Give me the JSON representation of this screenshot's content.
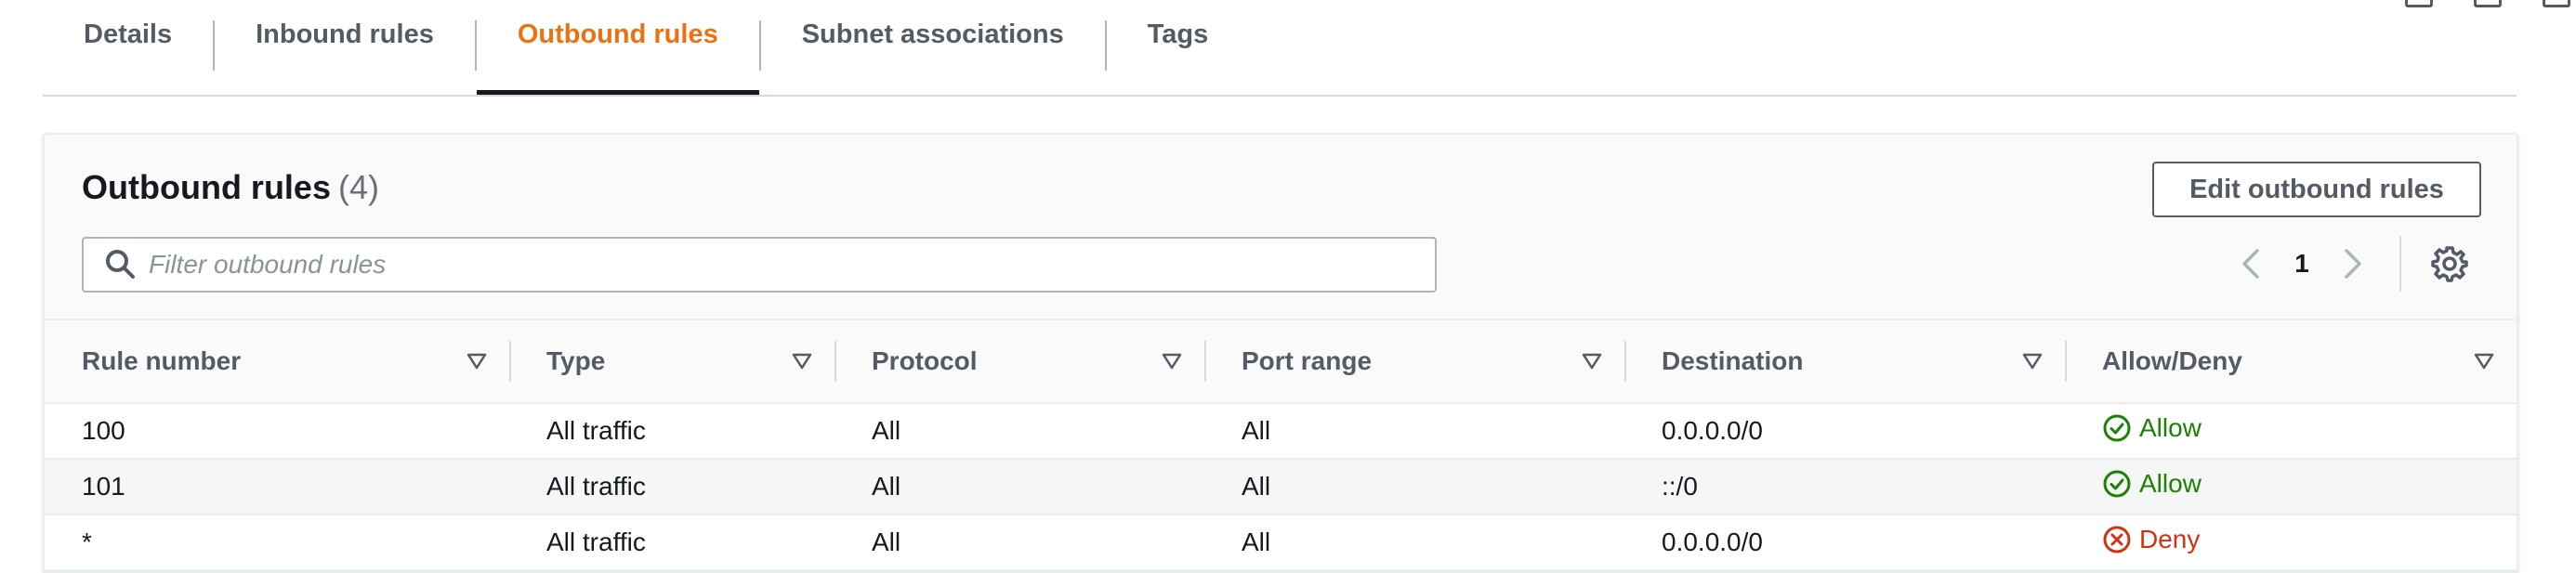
{
  "tabs": [
    {
      "label": "Details"
    },
    {
      "label": "Inbound rules"
    },
    {
      "label": "Outbound rules"
    },
    {
      "label": "Subnet associations"
    },
    {
      "label": "Tags"
    }
  ],
  "active_tab": "Outbound rules",
  "panel": {
    "title": "Outbound rules",
    "count": "(4)",
    "edit_button": "Edit outbound rules",
    "filter_placeholder": "Filter outbound rules",
    "page": "1"
  },
  "table": {
    "columns": [
      "Rule number",
      "Type",
      "Protocol",
      "Port range",
      "Destination",
      "Allow/Deny"
    ],
    "rows": [
      {
        "rule": "100",
        "type": "All traffic",
        "protocol": "All",
        "port": "All",
        "destination": "0.0.0.0/0",
        "action": "Allow"
      },
      {
        "rule": "101",
        "type": "All traffic",
        "protocol": "All",
        "port": "All",
        "destination": "::/0",
        "action": "Allow"
      },
      {
        "rule": "*",
        "type": "All traffic",
        "protocol": "All",
        "port": "All",
        "destination": "0.0.0.0/0",
        "action": "Deny"
      }
    ]
  },
  "colors": {
    "accent": "#ec7211",
    "allow": "#1d8102",
    "deny": "#d13212",
    "text": "#16191f",
    "muted": "#545b64"
  },
  "icons": {
    "search": "search-icon",
    "prev": "chevron-left-icon",
    "next": "chevron-right-icon",
    "settings": "gear-icon",
    "sort": "sort-caret-icon",
    "allow": "check-circle-icon",
    "deny": "x-circle-icon"
  }
}
